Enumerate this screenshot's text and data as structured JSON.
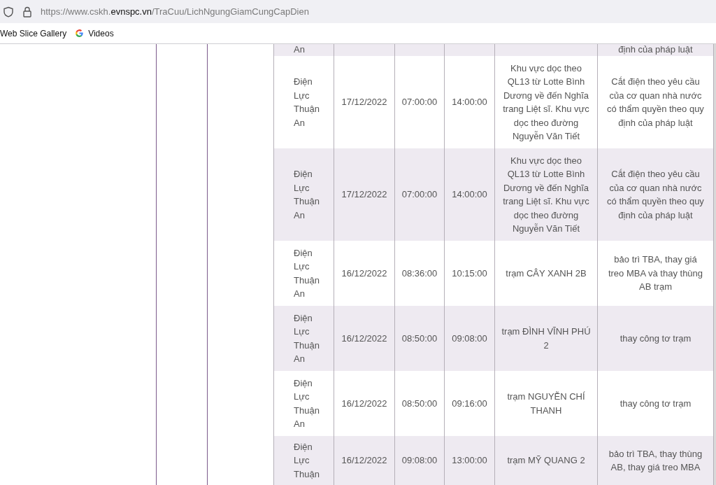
{
  "browser": {
    "url": {
      "prefix": "https://www.cskh.",
      "domain": "evnspc.vn",
      "path": "/TraCuu/LichNgungGiamCungCapDien"
    },
    "bookmarks": [
      {
        "label": "Web Slice Gallery",
        "kind": "plain"
      },
      {
        "label": "Videos",
        "kind": "google"
      }
    ]
  },
  "table": {
    "rows": [
      {
        "kind": "cut-top",
        "unit": "An",
        "reason": "định của pháp luật"
      },
      {
        "kind": "full",
        "unit": "Điện Lực Thuận An",
        "date": "17/12/2022",
        "start": "07:00:00",
        "end": "14:00:00",
        "area": "Khu vực dọc theo QL13 từ Lotte Bình Dương về đến Nghĩa trang Liệt sĩ. Khu vực dọc theo đường Nguyễn Văn Tiết",
        "reason": "Cắt điện theo yêu cầu của cơ quan nhà nước có thẩm quyền theo quy định của pháp luật"
      },
      {
        "kind": "full",
        "unit": "Điện Lực Thuận An",
        "date": "17/12/2022",
        "start": "07:00:00",
        "end": "14:00:00",
        "area": "Khu vực dọc theo QL13 từ Lotte Bình Dương về đến Nghĩa trang Liệt sĩ. Khu vực dọc theo đường Nguyễn Văn Tiết",
        "reason": "Cắt điện theo yêu cầu của cơ quan nhà nước có thẩm quyền theo quy định của pháp luật"
      },
      {
        "kind": "full",
        "unit": "Điện Lực Thuận An",
        "date": "16/12/2022",
        "start": "08:36:00",
        "end": "10:15:00",
        "area": "trạm CÂY XANH 2B",
        "reason": "bảo trì TBA, thay giá treo MBA và thay thùng AB trạm"
      },
      {
        "kind": "full",
        "unit": "Điện Lực Thuận An",
        "date": "16/12/2022",
        "start": "08:50:00",
        "end": "09:08:00",
        "area": "trạm ĐÌNH VĨNH PHÚ 2",
        "reason": "thay công tơ trạm"
      },
      {
        "kind": "full",
        "unit": "Điện Lực Thuận An",
        "date": "16/12/2022",
        "start": "08:50:00",
        "end": "09:16:00",
        "area": "trạm NGUYỄN CHÍ THANH",
        "reason": "thay công tơ trạm"
      },
      {
        "kind": "cut-bottom",
        "unit": "Điện Lực Thuận",
        "date": "16/12/2022",
        "start": "09:08:00",
        "end": "13:00:00",
        "area": "trạm MỸ QUANG 2",
        "reason": "bảo trì TBA, thay thùng AB, thay giá treo MBA"
      }
    ]
  }
}
